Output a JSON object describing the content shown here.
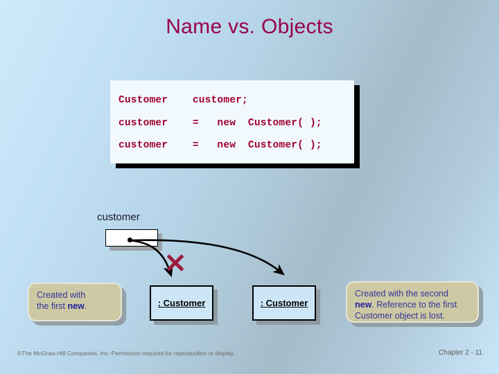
{
  "slide": {
    "title": "Name vs. Objects",
    "theme": {
      "title_color": "#99004d",
      "code_text_color": "#a00030",
      "code_bg": "#f2f9fe",
      "object_box_fill": "#cce6f7",
      "callout_fill": "#cdc9a4",
      "callout_text_color": "#333399",
      "x_mark_color": "#9e1b3c",
      "bg_from": "#cdeafa",
      "bg_to": "#a5bcc9"
    }
  },
  "code": {
    "lines": [
      "Customer    customer;",
      "customer    =   new  Customer( );",
      "customer    =   new  Customer( );"
    ]
  },
  "diagram": {
    "variable_label": "customer",
    "objects": [
      {
        "label": ": Customer"
      },
      {
        "label": ": Customer"
      }
    ],
    "x_mark_name": "broken-reference-x"
  },
  "callouts": [
    {
      "lines": [
        {
          "text": "Created with"
        },
        {
          "text": "the first ",
          "bold": "new",
          "tail": "."
        }
      ],
      "plain": "Created with the first new."
    },
    {
      "lines": [
        {
          "text": "Created with the second"
        },
        {
          "bold": "new",
          "tail": ". Reference to the first"
        },
        {
          "text": "Customer object is lost."
        }
      ],
      "plain": "Created with the second new. Reference to the first Customer object is lost."
    }
  ],
  "footer": {
    "copyright": "©The McGraw-Hill Companies, Inc. Permission required for reproduction or display.",
    "page": "Chapter 2 -  11"
  }
}
